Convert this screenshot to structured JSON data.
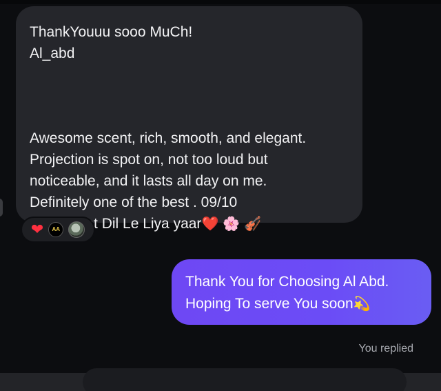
{
  "incoming_message": {
    "lines_top": [
      "ThankYouuu sooo MuCh!",
      "Al_abd"
    ],
    "lines_bottom": [
      "Awesome scent, rich, smooth, and elegant.",
      "Projection is spot on, not too loud but",
      "noticeable, and it lasts all day on me.",
      "Definitely one of the best . 09/10"
    ],
    "last_line_text": "Ufffff Lailat Dil Le Liya yaar",
    "last_line_emojis": [
      "❤️",
      "🌸",
      "🎻"
    ]
  },
  "reactions": {
    "items": [
      "heart",
      "brand-logo",
      "user-avatar"
    ],
    "heart_glyph": "❤",
    "logo_text": "AA"
  },
  "outgoing_message": {
    "line1": "Thank You for Choosing Al Abd.",
    "line2_text": "Hoping To serve You soon",
    "line2_emoji": "💫"
  },
  "status": {
    "you_replied": "You replied"
  },
  "colors": {
    "background": "#0c0d10",
    "incoming_bubble": "#25262b",
    "outgoing_bubble": "#6b4cf6",
    "status_text": "#a9abb1"
  }
}
